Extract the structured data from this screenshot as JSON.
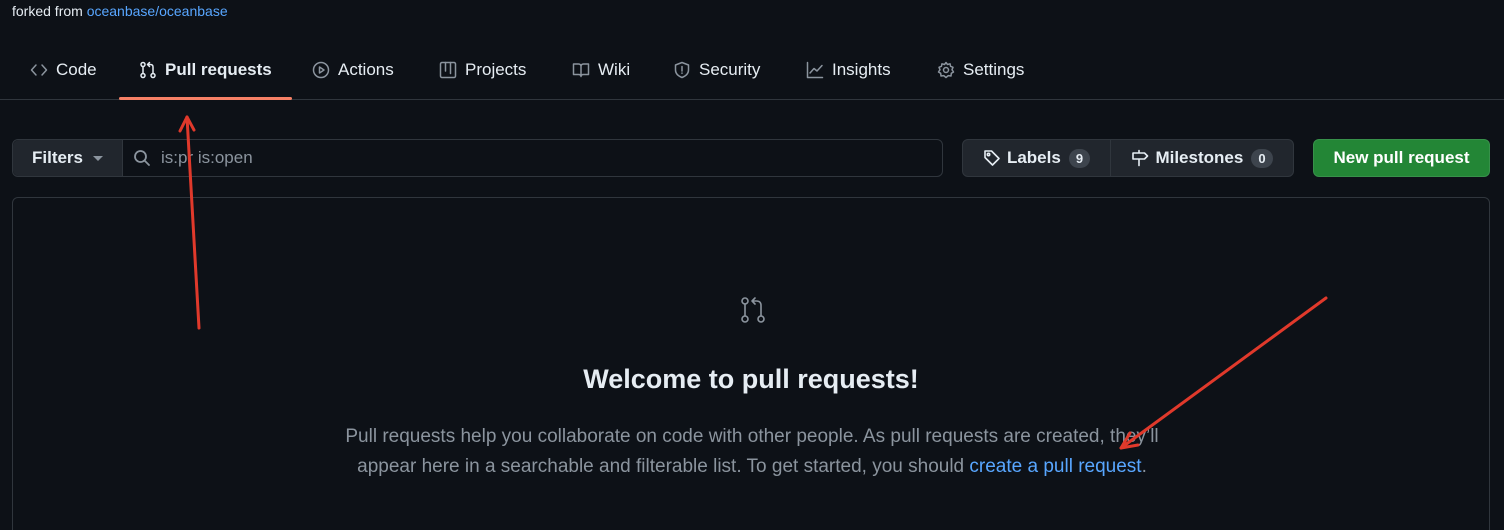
{
  "repo": {
    "forked_prefix": "forked from ",
    "forked_link": "oceanbase/oceanbase"
  },
  "tabs": [
    {
      "label": "Code",
      "icon": "code-icon"
    },
    {
      "label": "Pull requests",
      "icon": "git-pull-request-icon",
      "selected": true
    },
    {
      "label": "Actions",
      "icon": "play-icon"
    },
    {
      "label": "Projects",
      "icon": "table-icon"
    },
    {
      "label": "Wiki",
      "icon": "book-icon"
    },
    {
      "label": "Security",
      "icon": "shield-icon"
    },
    {
      "label": "Insights",
      "icon": "graph-icon"
    },
    {
      "label": "Settings",
      "icon": "gear-icon"
    }
  ],
  "toolbar": {
    "filters_label": "Filters",
    "search_value": "is:pr is:open",
    "labels_label": "Labels",
    "labels_count": "9",
    "milestones_label": "Milestones",
    "milestones_count": "0",
    "new_pr_label": "New pull request"
  },
  "blankslate": {
    "title": "Welcome to pull requests!",
    "body_before": "Pull requests help you collaborate on code with other people. As pull requests are created, they’ll appear here in a searchable and filterable list. To get started, you should ",
    "body_link": "create a pull request",
    "body_after": "."
  },
  "colors": {
    "background": "#0d1117",
    "border": "#30363d",
    "link": "#58a6ff",
    "primary_button": "#238636",
    "tab_underline": "#f78166",
    "annotation_arrow": "#e0392b"
  }
}
